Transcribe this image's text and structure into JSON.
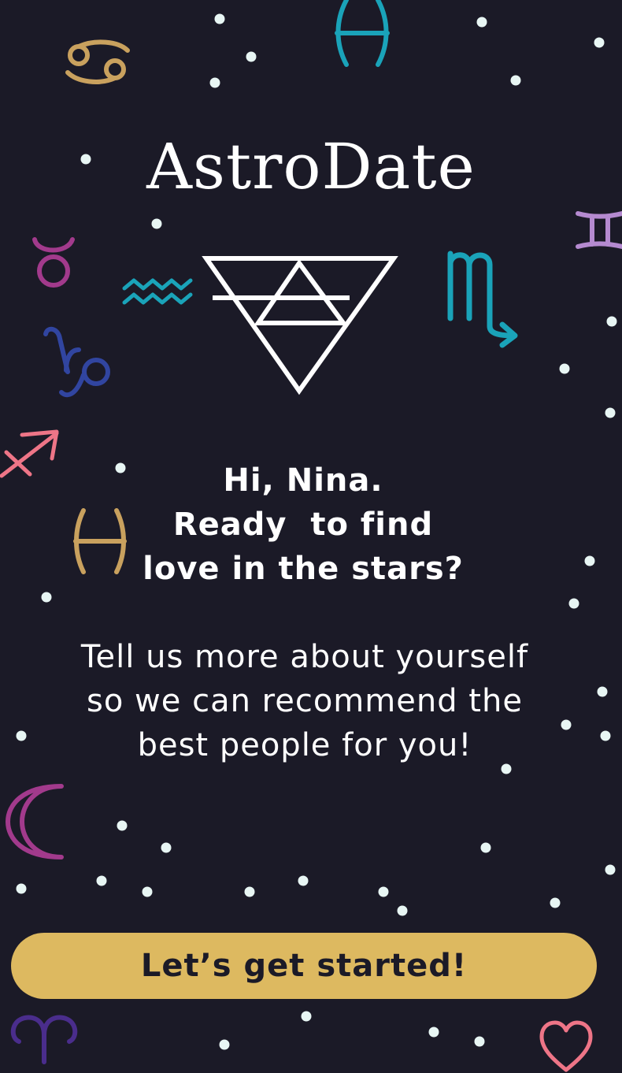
{
  "app": {
    "title": "AstroDate"
  },
  "greeting": {
    "lines": [
      "Hi, Nina.",
      "Ready  to find",
      "love in the stars?"
    ]
  },
  "description": {
    "lines": [
      "Tell us more about yourself",
      "so we can recommend the",
      "best people for you!"
    ]
  },
  "cta": {
    "label": "Let’s get started!"
  },
  "colors": {
    "background": "#1b1a27",
    "button": "#ddb960",
    "button_text": "#1b1a27",
    "text": "#ffffff",
    "star": "#e8f6f4",
    "gold": "#c9a15e",
    "teal": "#1aa3b9",
    "magenta": "#a23a8c",
    "blue": "#3145a0",
    "pink": "#ee7587",
    "lavender": "#b58ad0",
    "purple": "#4a2d8c"
  },
  "icons": [
    "cancer-icon",
    "pisces-icon",
    "gemini-icon",
    "taurus-icon",
    "aquarius-icon",
    "scorpio-icon",
    "capricorn-icon",
    "sagittarius-icon",
    "pisces-icon",
    "moon-icon",
    "aries-icon",
    "heart-icon",
    "earth-element-icon"
  ]
}
